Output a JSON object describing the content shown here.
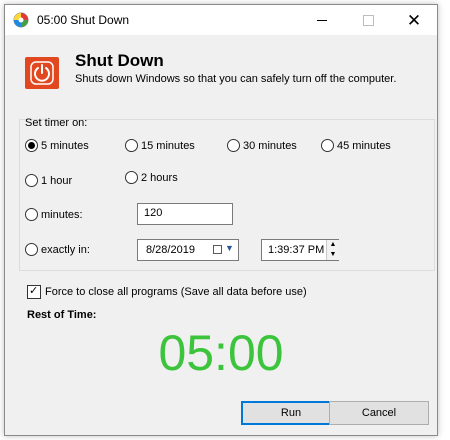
{
  "window": {
    "title": "05:00 Shut Down",
    "icon": "app-circle-icon"
  },
  "header": {
    "title": "Shut Down",
    "description": "Shuts down Windows so that you can safely turn off the computer.",
    "icon": "power-icon",
    "icon_color": "#e2481f"
  },
  "timer_group": {
    "label": "Set timer on:",
    "options": [
      {
        "label": "5 minutes",
        "checked": true
      },
      {
        "label": "15 minutes",
        "checked": false
      },
      {
        "label": "30 minutes",
        "checked": false
      },
      {
        "label": "45 minutes",
        "checked": false
      },
      {
        "label": "1 hour",
        "checked": false
      },
      {
        "label": "2 hours",
        "checked": false
      }
    ],
    "minutes_label": "minutes:",
    "minutes_value": "120",
    "exactly_label": "exactly in:",
    "date_value": "8/28/2019",
    "time_value": "1:39:37 PM"
  },
  "force_close": {
    "label": "Force to close all programs (Save all data before use)",
    "checked": true
  },
  "rest": {
    "label": "Rest of Time:",
    "countdown": "05:00",
    "countdown_color": "#3dc43d"
  },
  "buttons": {
    "run": "Run",
    "cancel": "Cancel"
  }
}
